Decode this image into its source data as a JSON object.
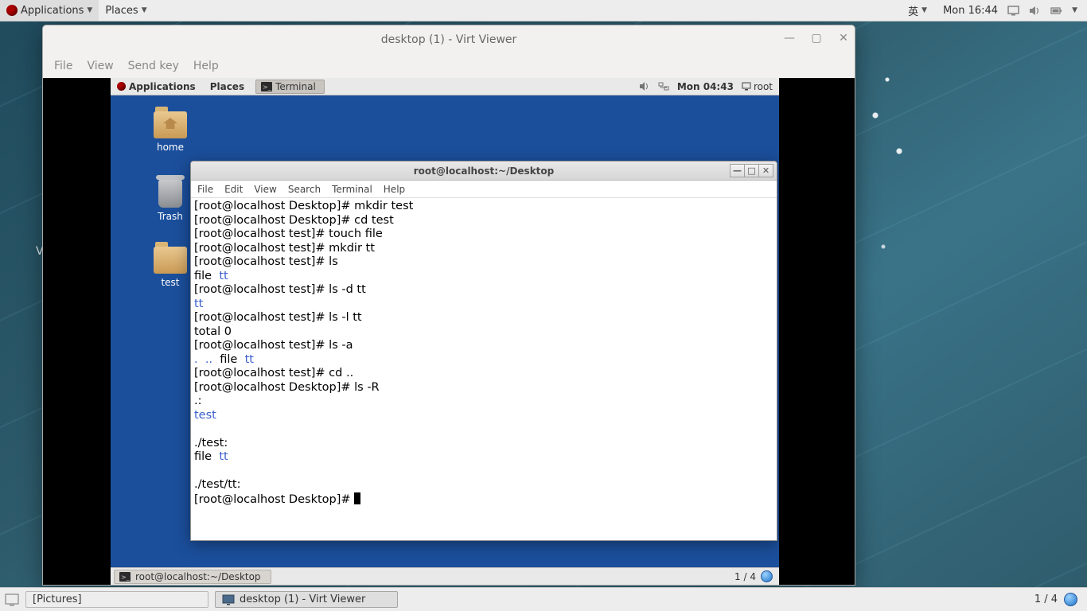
{
  "host_panel": {
    "applications": "Applications",
    "places": "Places",
    "ime": "英",
    "clock": "Mon 16:44"
  },
  "virt_viewer": {
    "title": "desktop (1) - Virt Viewer",
    "menu": {
      "file": "File",
      "view": "View",
      "sendkey": "Send key",
      "help": "Help"
    }
  },
  "guest_panel": {
    "applications": "Applications",
    "places": "Places",
    "task": "Terminal",
    "clock": "Mon 04:43",
    "user": "root"
  },
  "desktop_icons": {
    "home": "home",
    "trash": "Trash",
    "test": "test"
  },
  "terminal": {
    "title": "root@localhost:~/Desktop",
    "menu": {
      "file": "File",
      "edit": "Edit",
      "view": "View",
      "search": "Search",
      "terminal": "Terminal",
      "help": "Help"
    },
    "lines": [
      {
        "t": "[root@localhost Desktop]# mkdir test"
      },
      {
        "t": "[root@localhost Desktop]# cd test"
      },
      {
        "t": "[root@localhost test]# touch file"
      },
      {
        "t": "[root@localhost test]# mkdir tt"
      },
      {
        "t": "[root@localhost test]# ls"
      },
      {
        "segs": [
          {
            "t": "file  "
          },
          {
            "t": "tt",
            "c": "blue"
          }
        ]
      },
      {
        "t": "[root@localhost test]# ls -d tt"
      },
      {
        "segs": [
          {
            "t": "tt",
            "c": "blue"
          }
        ]
      },
      {
        "t": "[root@localhost test]# ls -l tt"
      },
      {
        "t": "total 0"
      },
      {
        "t": "[root@localhost test]# ls -a"
      },
      {
        "segs": [
          {
            "t": ".  ..",
            "c": "blue"
          },
          {
            "t": "  file  "
          },
          {
            "t": "tt",
            "c": "blue"
          }
        ]
      },
      {
        "t": "[root@localhost test]# cd .."
      },
      {
        "t": "[root@localhost Desktop]# ls -R"
      },
      {
        "t": ".:"
      },
      {
        "segs": [
          {
            "t": "test",
            "c": "blue"
          }
        ]
      },
      {
        "t": ""
      },
      {
        "t": "./test:"
      },
      {
        "segs": [
          {
            "t": "file  "
          },
          {
            "t": "tt",
            "c": "blue"
          }
        ]
      },
      {
        "t": ""
      },
      {
        "t": "./test/tt:"
      },
      {
        "segs": [
          {
            "t": "[root@localhost Desktop]# "
          },
          {
            "cursor": true
          }
        ]
      }
    ]
  },
  "guest_bottom": {
    "task": "root@localhost:~/Desktop",
    "workspace": "1 / 4"
  },
  "host_bottom": {
    "task1": "[Pictures]",
    "task2": "desktop (1) - Virt Viewer",
    "workspace": "1 / 4"
  }
}
